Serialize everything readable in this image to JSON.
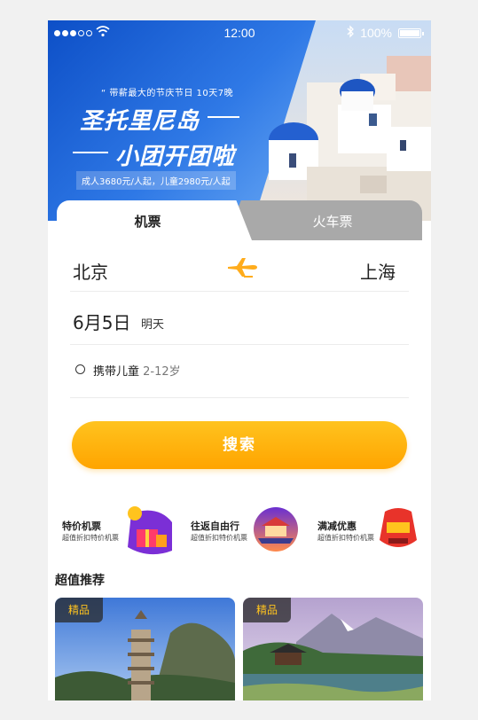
{
  "status_bar": {
    "time": "12:00",
    "battery": "100%"
  },
  "banner": {
    "subtitle": "“ 带薪最大的节庆节日 10天7晚",
    "title_line1": "圣托里尼岛",
    "title_line2": "小团开团啦",
    "price": "成人3680元/人起，儿童2980元/人起"
  },
  "tabs": [
    {
      "label": "机票",
      "active": true
    },
    {
      "label": "火车票",
      "active": false
    }
  ],
  "form": {
    "from_city": "北京",
    "to_city": "上海",
    "date": "6月5日",
    "date_note": "明天",
    "child_label": "携带儿童",
    "child_age": "2-12岁"
  },
  "search_button": "搜索",
  "features": [
    {
      "title": "特价机票",
      "subtitle": "超值折扣特价机票",
      "icon": "gift-icon"
    },
    {
      "title": "往返自由行",
      "subtitle": "超值折扣特价机票",
      "icon": "temple-icon"
    },
    {
      "title": "满减优惠",
      "subtitle": "超值折扣特价机票",
      "icon": "red-packet-icon"
    }
  ],
  "section_title": "超值推荐",
  "cards": [
    {
      "badge": "精品"
    },
    {
      "badge": "精品"
    }
  ],
  "colors": {
    "accent": "#ffaa00",
    "banner_blue": "#1a5fd6",
    "tab_gray": "#a9a9a9"
  }
}
